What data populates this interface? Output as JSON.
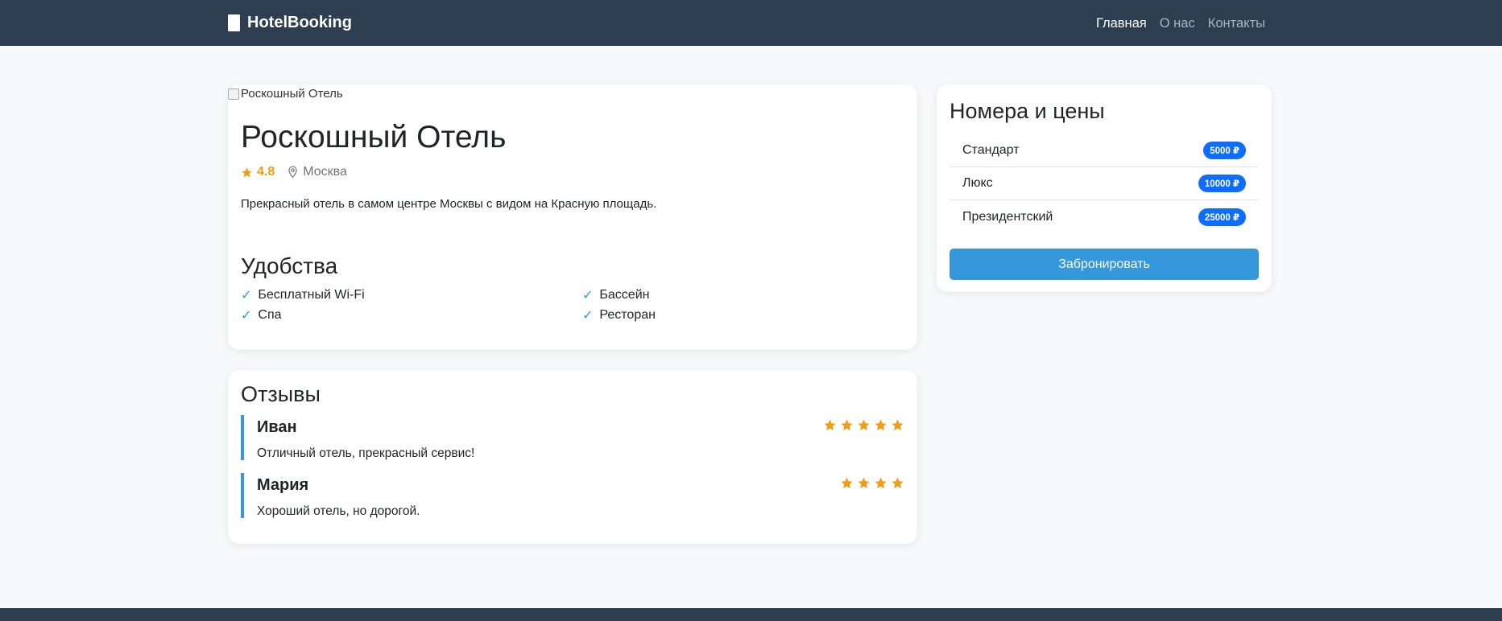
{
  "nav": {
    "brand": "HotelBooking",
    "links": [
      {
        "label": "Главная"
      },
      {
        "label": "О нас"
      },
      {
        "label": "Контакты"
      }
    ]
  },
  "hotel": {
    "image_alt": "Роскошный Отель",
    "name": "Роскошный Отель",
    "rating": "4.8",
    "location": "Москва",
    "description": "Прекрасный отель в самом центре Москвы с видом на Красную площадь.",
    "amenities_title": "Удобства",
    "amenities": [
      "Бесплатный Wi-Fi",
      "Бассейн",
      "Спа",
      "Ресторан"
    ]
  },
  "reviews": {
    "title": "Отзывы",
    "items": [
      {
        "name": "Иван",
        "stars": 5,
        "text": "Отличный отель, прекрасный сервис!"
      },
      {
        "name": "Мария",
        "stars": 4,
        "text": "Хороший отель, но дорогой."
      }
    ]
  },
  "rooms": {
    "title": "Номера и цены",
    "items": [
      {
        "name": "Стандарт",
        "price": "5000 ₽"
      },
      {
        "name": "Люкс",
        "price": "10000 ₽"
      },
      {
        "name": "Президентский",
        "price": "25000 ₽"
      }
    ],
    "book_label": "Забронировать"
  },
  "colors": {
    "navbar": "#2c3e50",
    "accent": "#3498db",
    "star": "#f39c12",
    "badge": "#0d6efd"
  },
  "icons": {
    "brand": "hotel-building-icon",
    "rating": "star-icon",
    "location": "map-pin-icon",
    "amenity": "check-icon"
  }
}
